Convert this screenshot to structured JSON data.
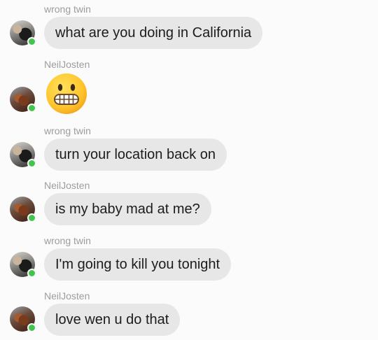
{
  "messages": [
    {
      "sender": "wrong twin",
      "text": "what are you doing in California"
    },
    {
      "sender": "NeilJosten",
      "emoji": "grimacing-face"
    },
    {
      "sender": "wrong twin",
      "text": "turn your location back on"
    },
    {
      "sender": "NeilJosten",
      "text": "is my baby mad at me?"
    },
    {
      "sender": "wrong twin",
      "text": "I'm going to kill you tonight"
    },
    {
      "sender": "NeilJosten",
      "text": "love wen u do that"
    }
  ],
  "colors": {
    "background": "#fbfbfb",
    "bubble": "#e7e7e7",
    "sender_label": "#9c9c9c",
    "online_status": "#42c44f"
  }
}
